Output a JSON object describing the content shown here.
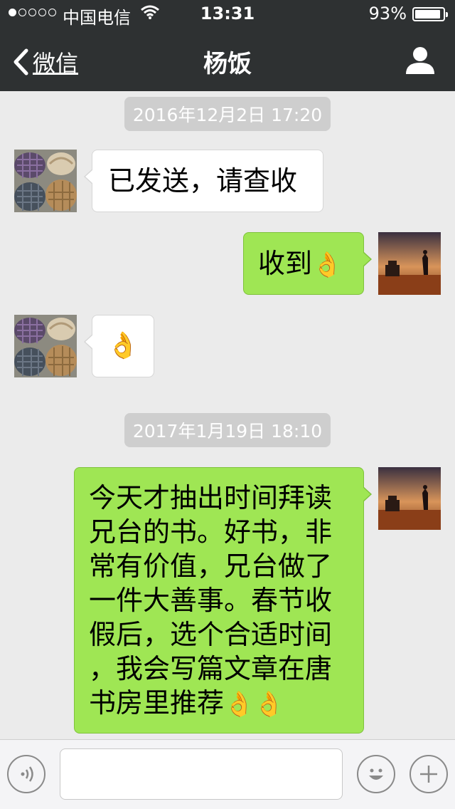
{
  "status_bar": {
    "carrier": "中国电信",
    "time": "13:31",
    "battery_percent": "93%",
    "battery_level": 0.93,
    "signal_bars": 1,
    "signal_total": 5
  },
  "nav": {
    "back_label": "微信",
    "title": "杨饭",
    "profile_icon": "person-icon"
  },
  "messages": [
    {
      "type": "timestamp",
      "text": "2016年12月2日 17:20"
    },
    {
      "type": "message",
      "side": "left",
      "text": "已发送，请查收"
    },
    {
      "type": "message",
      "side": "right",
      "text": "收到",
      "emoji": "👌"
    },
    {
      "type": "message",
      "side": "left",
      "text": "",
      "emoji": "👌"
    },
    {
      "type": "timestamp",
      "text": "2017年1月19日 18:10"
    },
    {
      "type": "message",
      "side": "right",
      "lines": [
        "今天才抽出时间拜读",
        "兄台的书。好书，非",
        "常有价值，兄台做了",
        "一件大善事。春节收",
        "假后，选个合适时间",
        "，我会写篇文章在唐",
        "书房里推荐"
      ],
      "emoji": "👌👌"
    }
  ],
  "input_bar": {
    "voice_icon": "voice-icon",
    "emoji_icon": "emoji-icon",
    "plus_icon": "plus-icon",
    "placeholder": ""
  },
  "colors": {
    "nav_bg": "#2e3132",
    "chat_bg": "#ebebeb",
    "bubble_sent": "#9fe654",
    "bubble_received": "#ffffff",
    "timestamp_bg": "#cecece"
  }
}
